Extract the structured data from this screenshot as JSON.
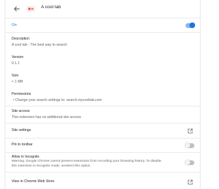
{
  "header": {
    "title": "A cool tab"
  },
  "on_label": "On",
  "description": {
    "label": "Description",
    "value": "A cool tab - The best way to search"
  },
  "version": {
    "label": "Version",
    "value": "0.1.1"
  },
  "size": {
    "label": "Size",
    "value": "< 1 MB"
  },
  "permissions": {
    "label": "Permissions",
    "items": [
      "Change your search settings to: search.mycooltab.com"
    ]
  },
  "site_access": {
    "label": "Site access",
    "value": "This extension has no additional site access."
  },
  "site_settings": {
    "label": "Site settings"
  },
  "pin_to_toolbar": {
    "label": "Pin to toolbar",
    "enabled": false
  },
  "incognito": {
    "label": "Allow in Incognito",
    "warning_line1": "Warning: Google Chrome cannot prevent extensions from recording your browsing history. To disable",
    "warning_line2": "this extension in Incognito mode, unselect this option.",
    "enabled": false
  },
  "web_store": {
    "label": "View in Chrome Web Store"
  },
  "colors": {
    "accent": "#1a73e8",
    "text": "#202124",
    "secondary": "#5f6368",
    "icon_red": "#ea4335"
  }
}
